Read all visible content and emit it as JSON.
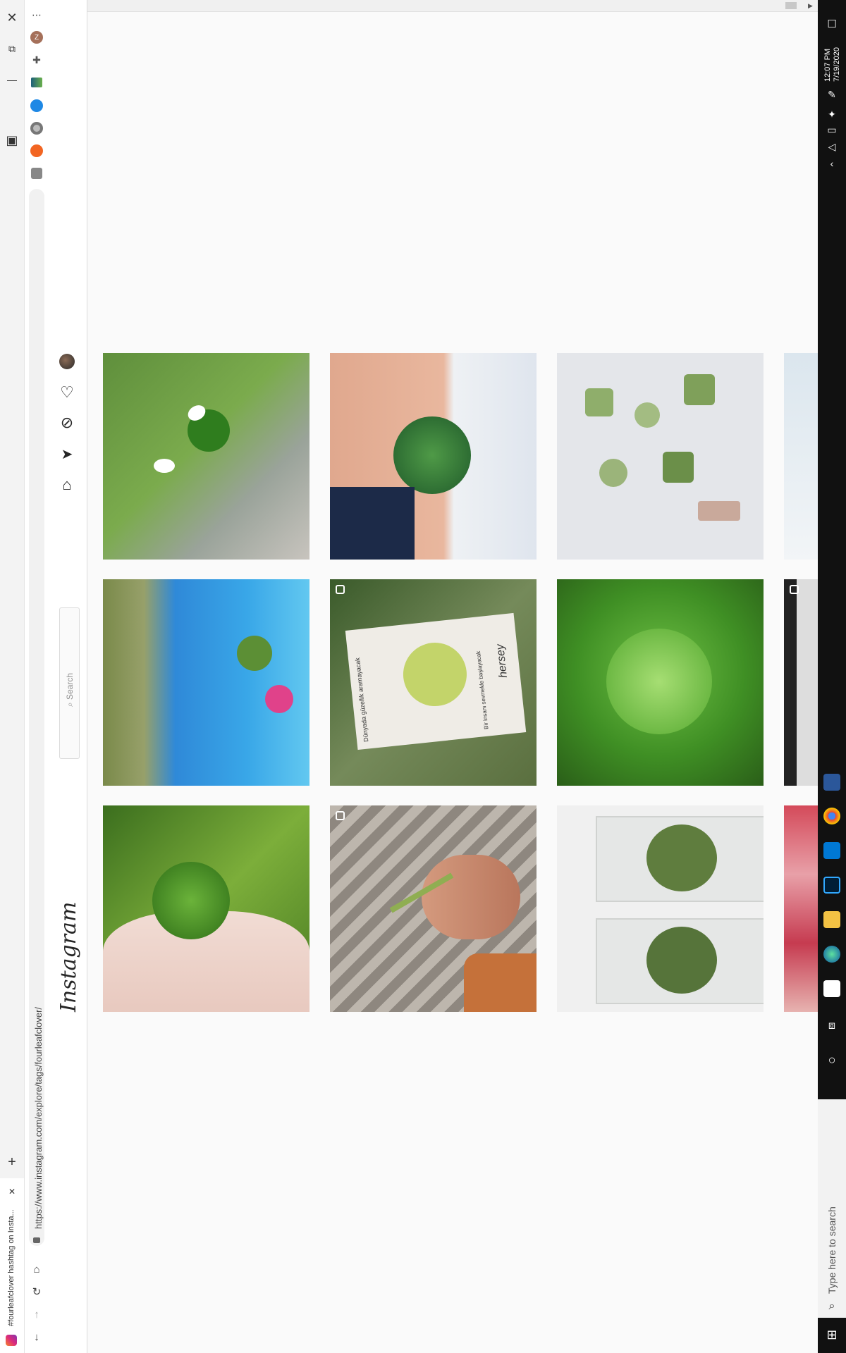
{
  "browser": {
    "tab_title": "#fourleafclover hashtag on Insta...",
    "url": "https://www.instagram.com/explore/tags/fourleafclover/",
    "profile_initial": "Z"
  },
  "instagram": {
    "logo": "Instagram",
    "search_placeholder": "Search"
  },
  "taskbar": {
    "time": "12:07 PM",
    "date": "7/19/2020",
    "search_placeholder": "Type here to search"
  },
  "grid": {
    "tiles": [
      {
        "name": "clover-in-hand-grass",
        "multi": false
      },
      {
        "name": "clover-leg-tattoo",
        "multi": false
      },
      {
        "name": "resin-clover-charms",
        "multi": false
      },
      {
        "name": "clover-by-pool",
        "multi": false
      },
      {
        "name": "clover-watercolor-card",
        "multi": true
      },
      {
        "name": "clover-closeup",
        "multi": false
      },
      {
        "name": "clover-in-palm",
        "multi": false
      },
      {
        "name": "praying-mantis-on-finger",
        "multi": true
      },
      {
        "name": "clovers-in-acrylic-blocks",
        "multi": false
      }
    ]
  },
  "card_text": {
    "line1": "Dünyada güzellik aramayacak",
    "line2": "Bir insanı sevmekle başlayacak",
    "name": "hersey"
  },
  "colors": {
    "accent": "#0095f6",
    "background": "#fafafa",
    "taskbar": "#111111"
  }
}
